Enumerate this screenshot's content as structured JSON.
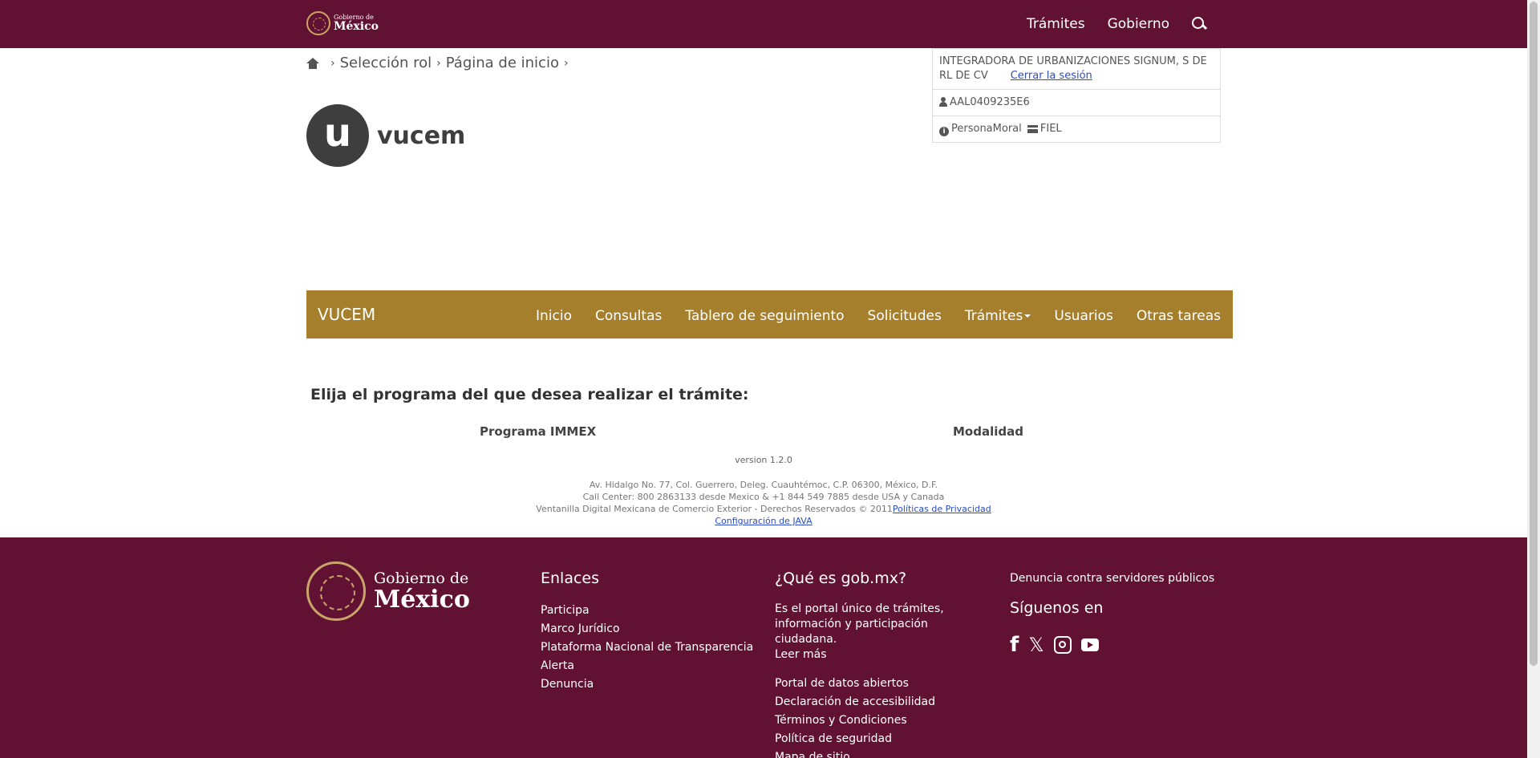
{
  "topbar": {
    "logo_small": "Gobierno de",
    "logo_big": "México",
    "nav": [
      "Trámites",
      "Gobierno"
    ]
  },
  "breadcrumb": [
    "Selección rol",
    "Página de inicio"
  ],
  "vucem_logo": {
    "letter": "u",
    "word": "vucem"
  },
  "session": {
    "company": "INTEGRADORA DE URBANIZACIONES SIGNUM, S DE RL DE CV",
    "logout": "Cerrar la sesión",
    "rfc": "AAL0409235E6",
    "persona": "PersonaMoral",
    "auth": "FIEL"
  },
  "navbar": {
    "brand": "VUCEM",
    "items": [
      "Inicio",
      "Consultas",
      "Tablero de seguimiento",
      "Solicitudes",
      "Trámites",
      "Usuarios",
      "Otras tareas"
    ]
  },
  "main": {
    "title": "Elija el programa del que desea realizar el trámite:",
    "col1": "Programa IMMEX",
    "col2": "Modalidad"
  },
  "version": "version 1.2.0",
  "footer_info": {
    "line1": "Av. Hidalgo No. 77, Col. Guerrero, Deleg. Cuauhtémoc, C.P. 06300, México, D.F.",
    "line2": "Call Center: 800 2863133 desde Mexico & +1 844 549 7885 desde USA y Canada",
    "line3": "Ventanilla Digital Mexicana de Comercio Exterior - Derechos Reservados © 2011",
    "privacy": "Políticas de Privacidad",
    "java": "Configuración de JAVA"
  },
  "footer": {
    "logo_small": "Gobierno de",
    "logo_big": "México",
    "enlaces_title": "Enlaces",
    "enlaces": [
      "Participa",
      "Marco Jurídico",
      "Plataforma Nacional de Transparencia",
      "Alerta",
      "Denuncia"
    ],
    "que_title": "¿Qué es gob.mx?",
    "que_text": "Es el portal único de trámites, información y participación ciudadana.",
    "leer_mas": "Leer más",
    "que_links": [
      "Portal de datos abiertos",
      "Declaración de accesibilidad",
      "Términos y Condiciones",
      "Política de seguridad",
      "Mapa de sitio"
    ],
    "denuncia": "Denuncia contra servidores públicos",
    "siguenos": "Síguenos en",
    "x_glyph": "𝕏"
  },
  "colors": {
    "brand": "#611232",
    "gold": "#a57f2c"
  }
}
